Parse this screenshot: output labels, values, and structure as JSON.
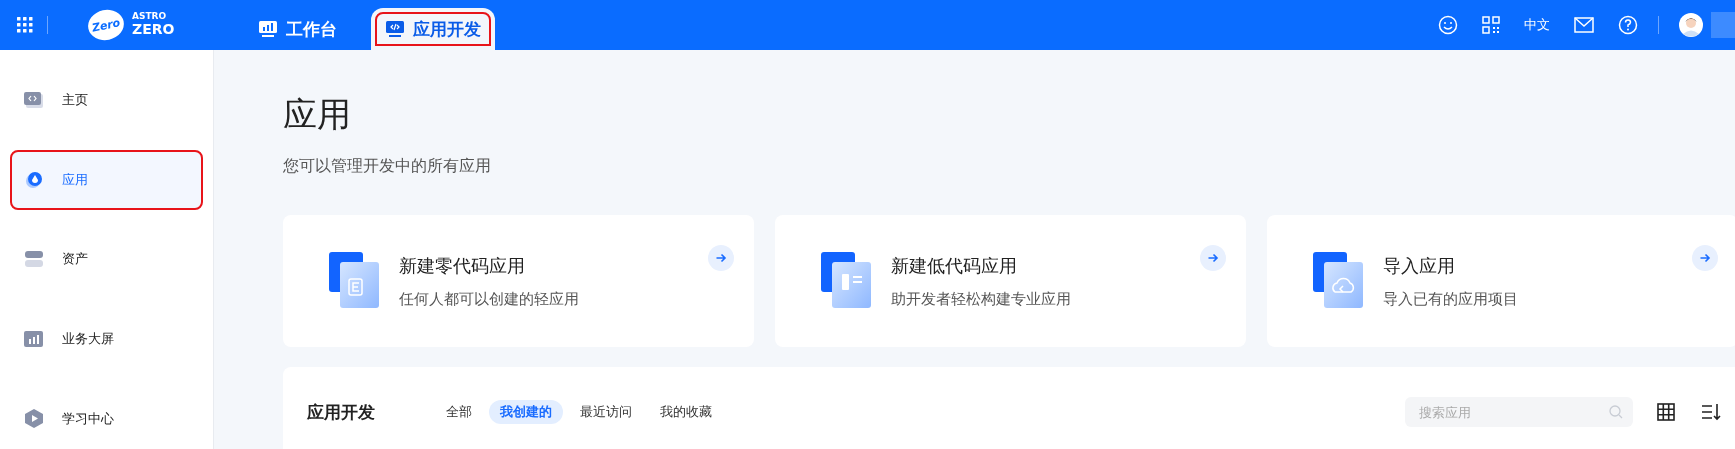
{
  "header": {
    "logo_top": "ASTRO",
    "logo_bottom": "ZERO",
    "logo_badge": "Zero",
    "tabs": [
      {
        "label": "工作台",
        "selected": false,
        "highlighted": false
      },
      {
        "label": "应用开发",
        "selected": true,
        "highlighted": true
      }
    ],
    "language": "中文"
  },
  "sidebar": {
    "items": [
      {
        "label": "主页",
        "selected": false,
        "highlighted": false
      },
      {
        "label": "应用",
        "selected": true,
        "highlighted": true
      },
      {
        "label": "资产",
        "selected": false,
        "highlighted": false
      },
      {
        "label": "业务大屏",
        "selected": false,
        "highlighted": false
      },
      {
        "label": "学习中心",
        "selected": false,
        "highlighted": false
      }
    ]
  },
  "page": {
    "title": "应用",
    "subtitle": "您可以管理开发中的所有应用"
  },
  "cards": [
    {
      "title": "新建零代码应用",
      "description": "任何人都可以创建的轻应用"
    },
    {
      "title": "新建低代码应用",
      "description": "助开发者轻松构建专业应用"
    },
    {
      "title": "导入应用",
      "description": "导入已有的应用项目"
    }
  ],
  "apps_panel": {
    "title": "应用开发",
    "filters": [
      {
        "label": "全部",
        "selected": false
      },
      {
        "label": "我创建的",
        "selected": true
      },
      {
        "label": "最近访问",
        "selected": false
      },
      {
        "label": "我的收藏",
        "selected": false
      }
    ],
    "search": {
      "placeholder": "搜索应用"
    }
  }
}
